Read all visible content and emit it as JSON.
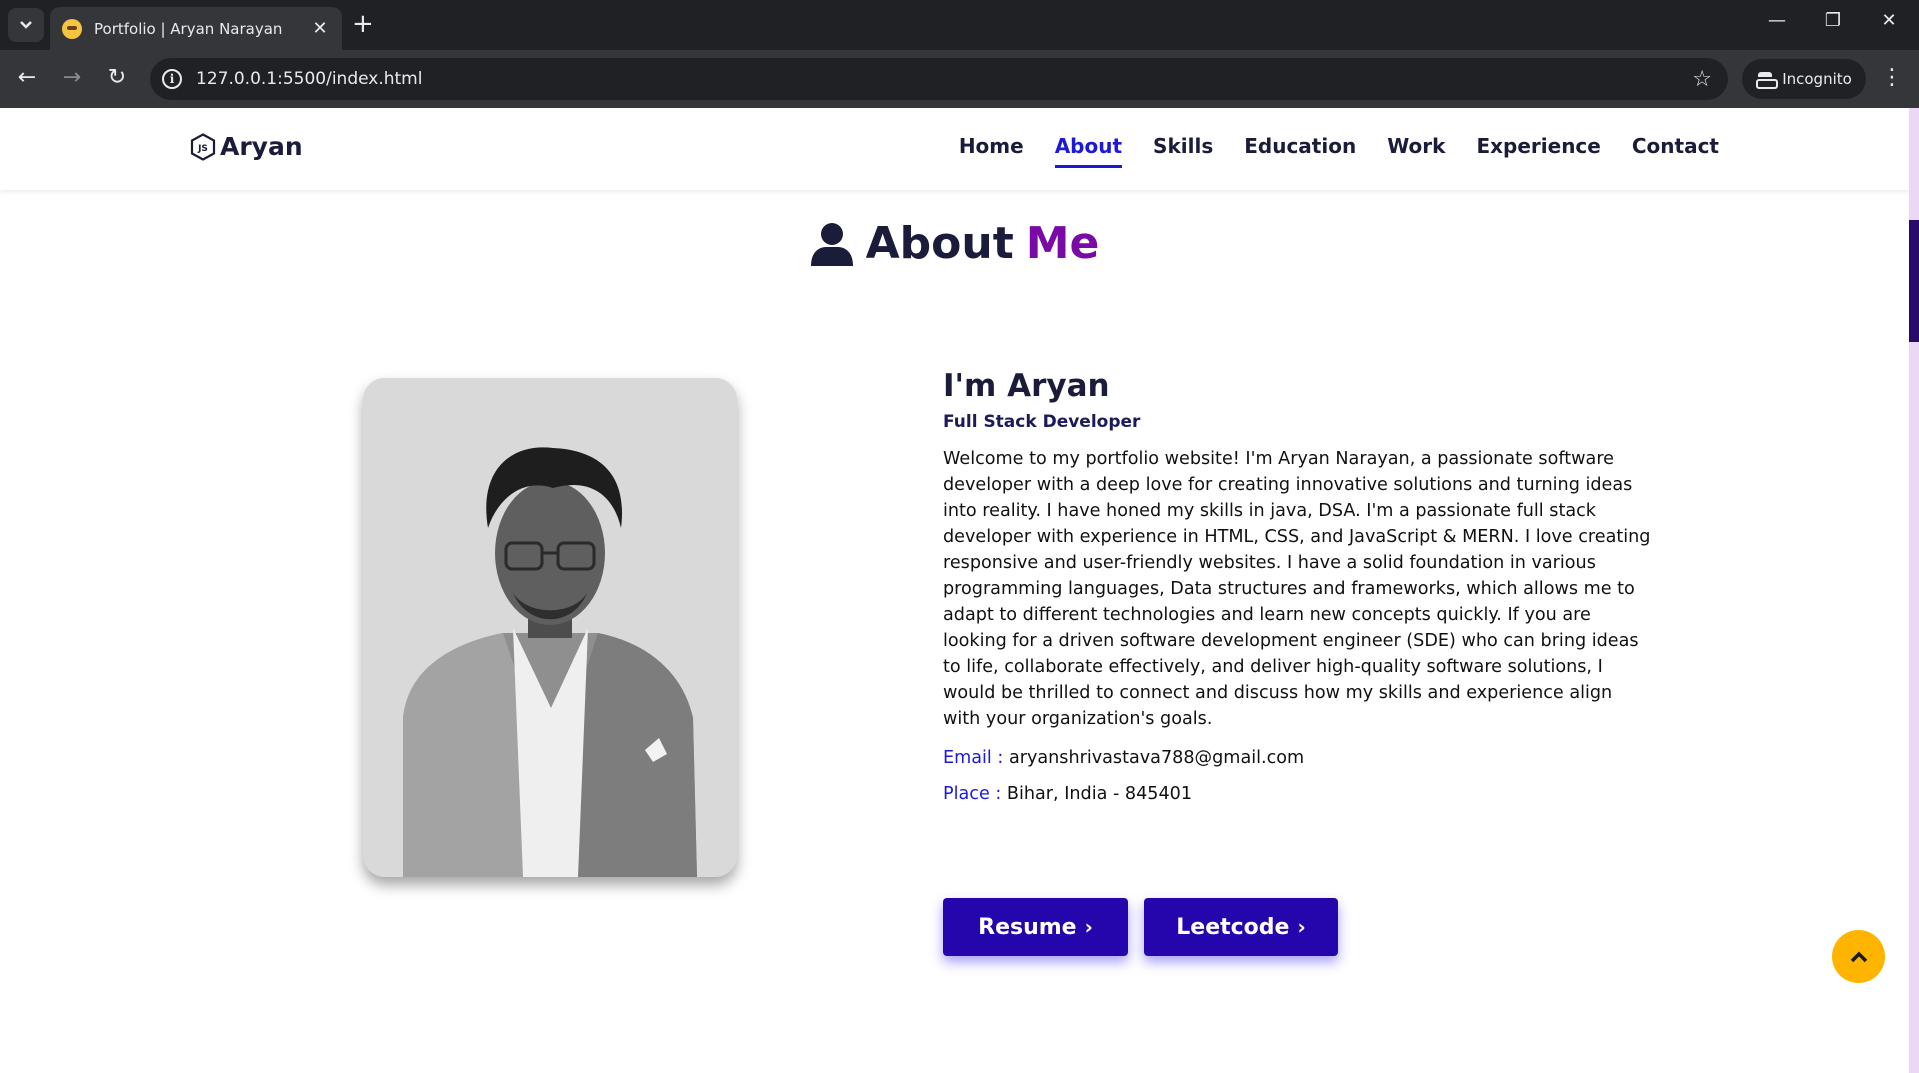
{
  "browser": {
    "tab_title": "Portfolio | Aryan Narayan",
    "url": "127.0.0.1:5500/index.html",
    "incognito_label": "Incognito"
  },
  "site": {
    "logo_text": "Aryan",
    "nav": [
      {
        "label": "Home"
      },
      {
        "label": "About",
        "active": true
      },
      {
        "label": "Skills"
      },
      {
        "label": "Education"
      },
      {
        "label": "Work"
      },
      {
        "label": "Experience"
      },
      {
        "label": "Contact"
      }
    ]
  },
  "about": {
    "heading_main": "About",
    "heading_accent": "Me",
    "name": "I'm Aryan",
    "role": "Full Stack Developer",
    "bio": "Welcome to my portfolio website! I'm Aryan Narayan, a passionate software developer with a deep love for creating innovative solutions and turning ideas into reality. I have honed my skills in java, DSA. I'm a passionate full stack developer with experience in HTML, CSS, and JavaScript & MERN. I love creating responsive and user-friendly websites. I have a solid foundation in various programming languages, Data structures and frameworks, which allows me to adapt to different technologies and learn new concepts quickly. If you are looking for a driven software development engineer (SDE) who can bring ideas to life, collaborate effectively, and deliver high-quality software solutions, I would be thrilled to connect and discuss how my skills and experience align with your organization's goals.",
    "email_label": "Email :",
    "email": "aryanshrivastava788@gmail.com",
    "place_label": "Place :",
    "place": "Bihar, India - 845401",
    "buttons": [
      {
        "label": "Resume"
      },
      {
        "label": "Leetcode"
      }
    ]
  },
  "colors": {
    "accent": "#1c1ad6",
    "heading_accent": "#7a0aa5",
    "button_bg": "#2506ad",
    "scroll_top_bg": "#ffb400"
  }
}
